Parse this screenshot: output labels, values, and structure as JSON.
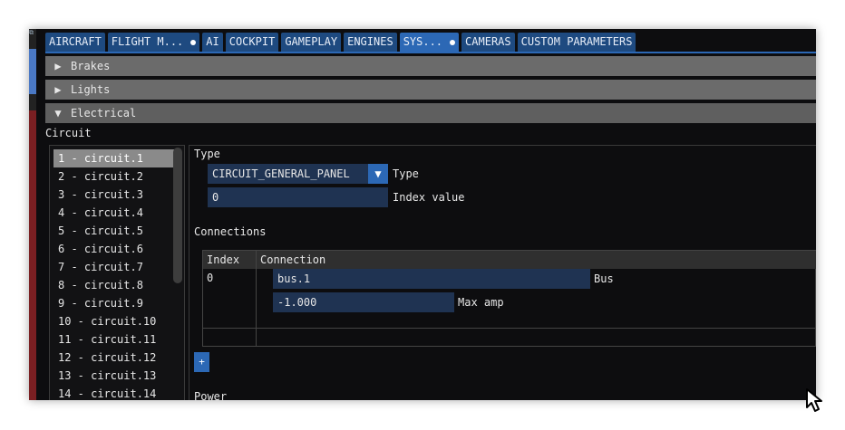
{
  "tabs": [
    {
      "label": "AIRCRAFT",
      "dot": false,
      "active": false
    },
    {
      "label": "FLIGHT M...",
      "dot": true,
      "active": false
    },
    {
      "label": "AI",
      "dot": false,
      "active": false
    },
    {
      "label": "COCKPIT",
      "dot": false,
      "active": false
    },
    {
      "label": "GAMEPLAY",
      "dot": false,
      "active": false
    },
    {
      "label": "ENGINES",
      "dot": false,
      "active": false
    },
    {
      "label": "SYS...",
      "dot": true,
      "active": true
    },
    {
      "label": "CAMERAS",
      "dot": false,
      "active": false
    },
    {
      "label": "CUSTOM PARAMETERS",
      "dot": false,
      "active": false
    }
  ],
  "sections": {
    "brakes": {
      "label": "Brakes",
      "icon": "triangle-right"
    },
    "lights": {
      "label": "Lights",
      "icon": "triangle-right"
    },
    "electrical": {
      "label": "Electrical",
      "icon": "triangle-down"
    }
  },
  "circuit": {
    "label": "Circuit",
    "items": [
      "1 - circuit.1",
      "2 - circuit.2",
      "3 - circuit.3",
      "4 - circuit.4",
      "5 - circuit.5",
      "6 - circuit.6",
      "7 - circuit.7",
      "8 - circuit.8",
      "9 - circuit.9",
      "10 - circuit.10",
      "11 - circuit.11",
      "12 - circuit.12",
      "13 - circuit.13",
      "14 - circuit.14"
    ],
    "selected_index": 0
  },
  "detail": {
    "type_heading": "Type",
    "type_value": "CIRCUIT_GENERAL_PANEL",
    "type_label": "Type",
    "dropdown_arrow": "▼",
    "index_value": "0",
    "index_label": "Index value",
    "connections_heading": "Connections",
    "table": {
      "headers": [
        "Index",
        "Connection"
      ],
      "rows": [
        {
          "index": "0",
          "bus_value": "bus.1",
          "bus_label": "Bus",
          "amp_value": "-1.000",
          "amp_label": "Max amp"
        }
      ]
    },
    "add_label": "+",
    "power_heading": "Power"
  },
  "colors": {
    "tab": "#1e4a80",
    "tab_active": "#2c68b5",
    "header": "#6b6b6b",
    "field": "#1f3352",
    "background": "#0d0d0f"
  }
}
